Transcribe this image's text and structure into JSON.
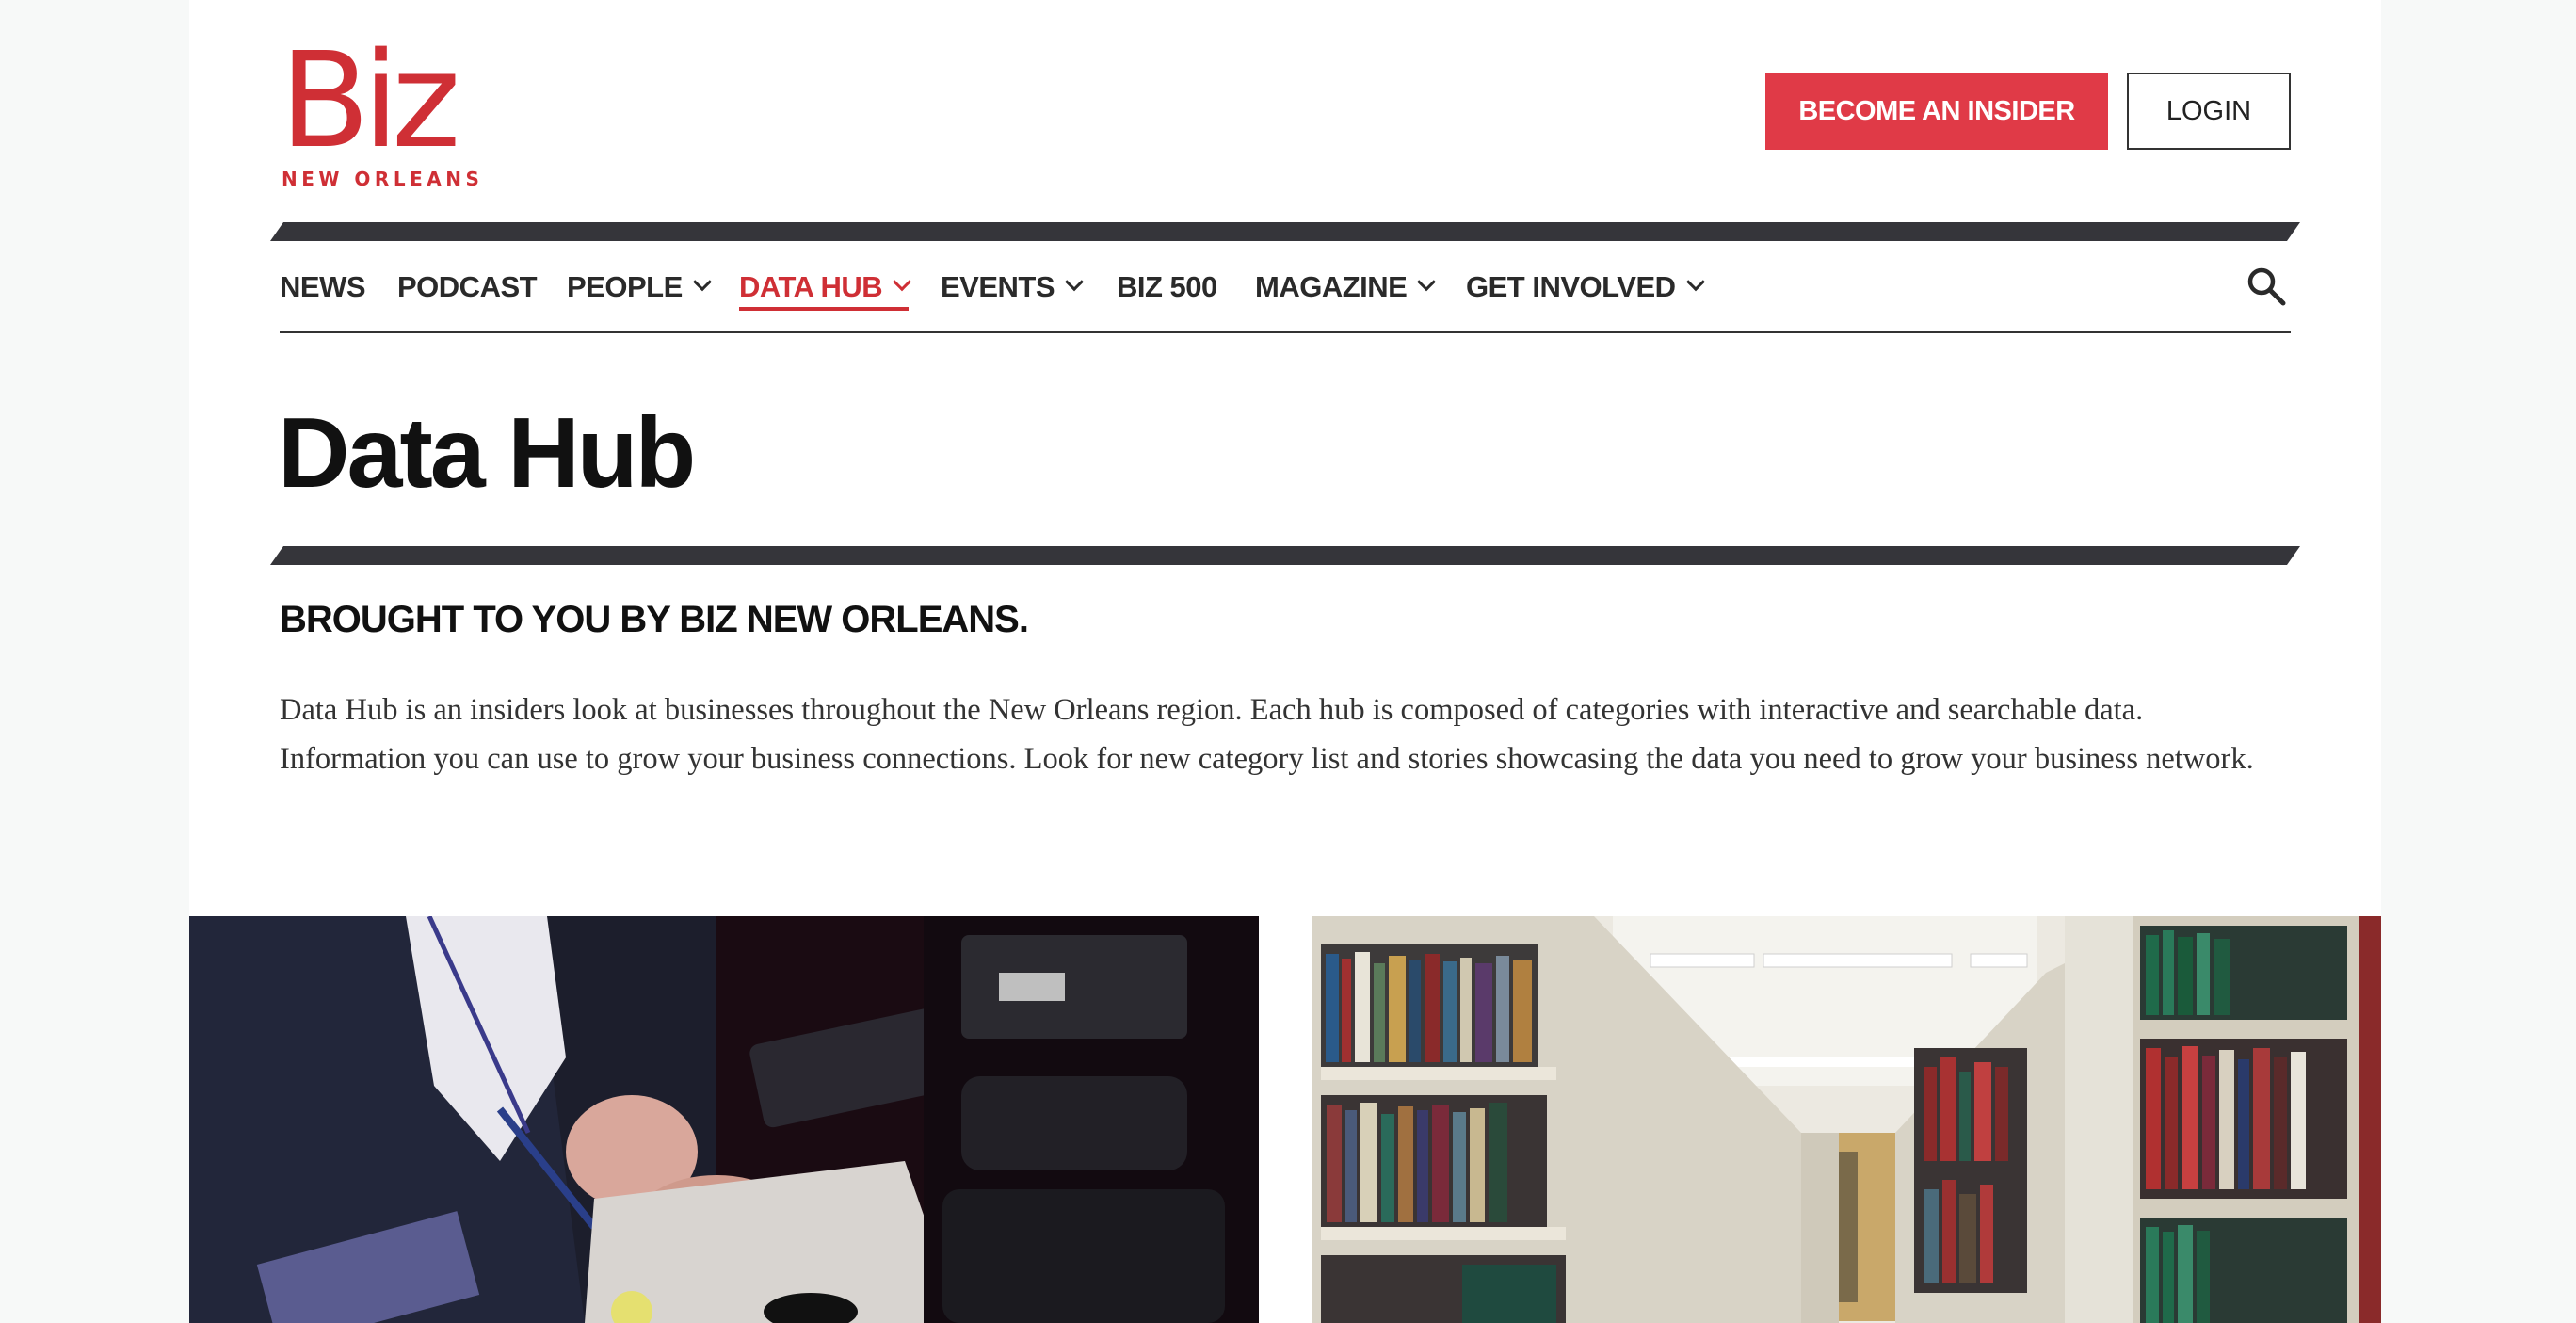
{
  "brand": {
    "logo_main": "Biz",
    "logo_sub": "NEW ORLEANS",
    "color": "#cf2f35"
  },
  "header": {
    "insider_button": "BECOME AN INSIDER",
    "login_button": "LOGIN"
  },
  "nav": {
    "items": [
      {
        "label": "NEWS",
        "dropdown": false,
        "active": false
      },
      {
        "label": "PODCAST",
        "dropdown": false,
        "active": false
      },
      {
        "label": "PEOPLE",
        "dropdown": true,
        "active": false
      },
      {
        "label": "DATA HUB",
        "dropdown": true,
        "active": true
      },
      {
        "label": "EVENTS",
        "dropdown": true,
        "active": false
      },
      {
        "label": "BIZ 500",
        "dropdown": false,
        "active": false
      },
      {
        "label": "MAGAZINE",
        "dropdown": true,
        "active": false
      },
      {
        "label": "GET INVOLVED",
        "dropdown": true,
        "active": false
      }
    ],
    "search_icon": "search-icon",
    "active_color": "#cf2f35"
  },
  "main": {
    "title": "Data Hub",
    "subhead": "BROUGHT TO YOU BY BIZ NEW ORLEANS.",
    "intro": "Data Hub is an insiders look at businesses throughout the New Orleans region. Each hub is composed of categories with interactive and searchable data. Information you can use to grow your business connections. Look for new category list and stories showcasing the data you need to grow your business network."
  },
  "accent_colors": {
    "button_red": "#e03a47",
    "stripe": "#35353a"
  }
}
